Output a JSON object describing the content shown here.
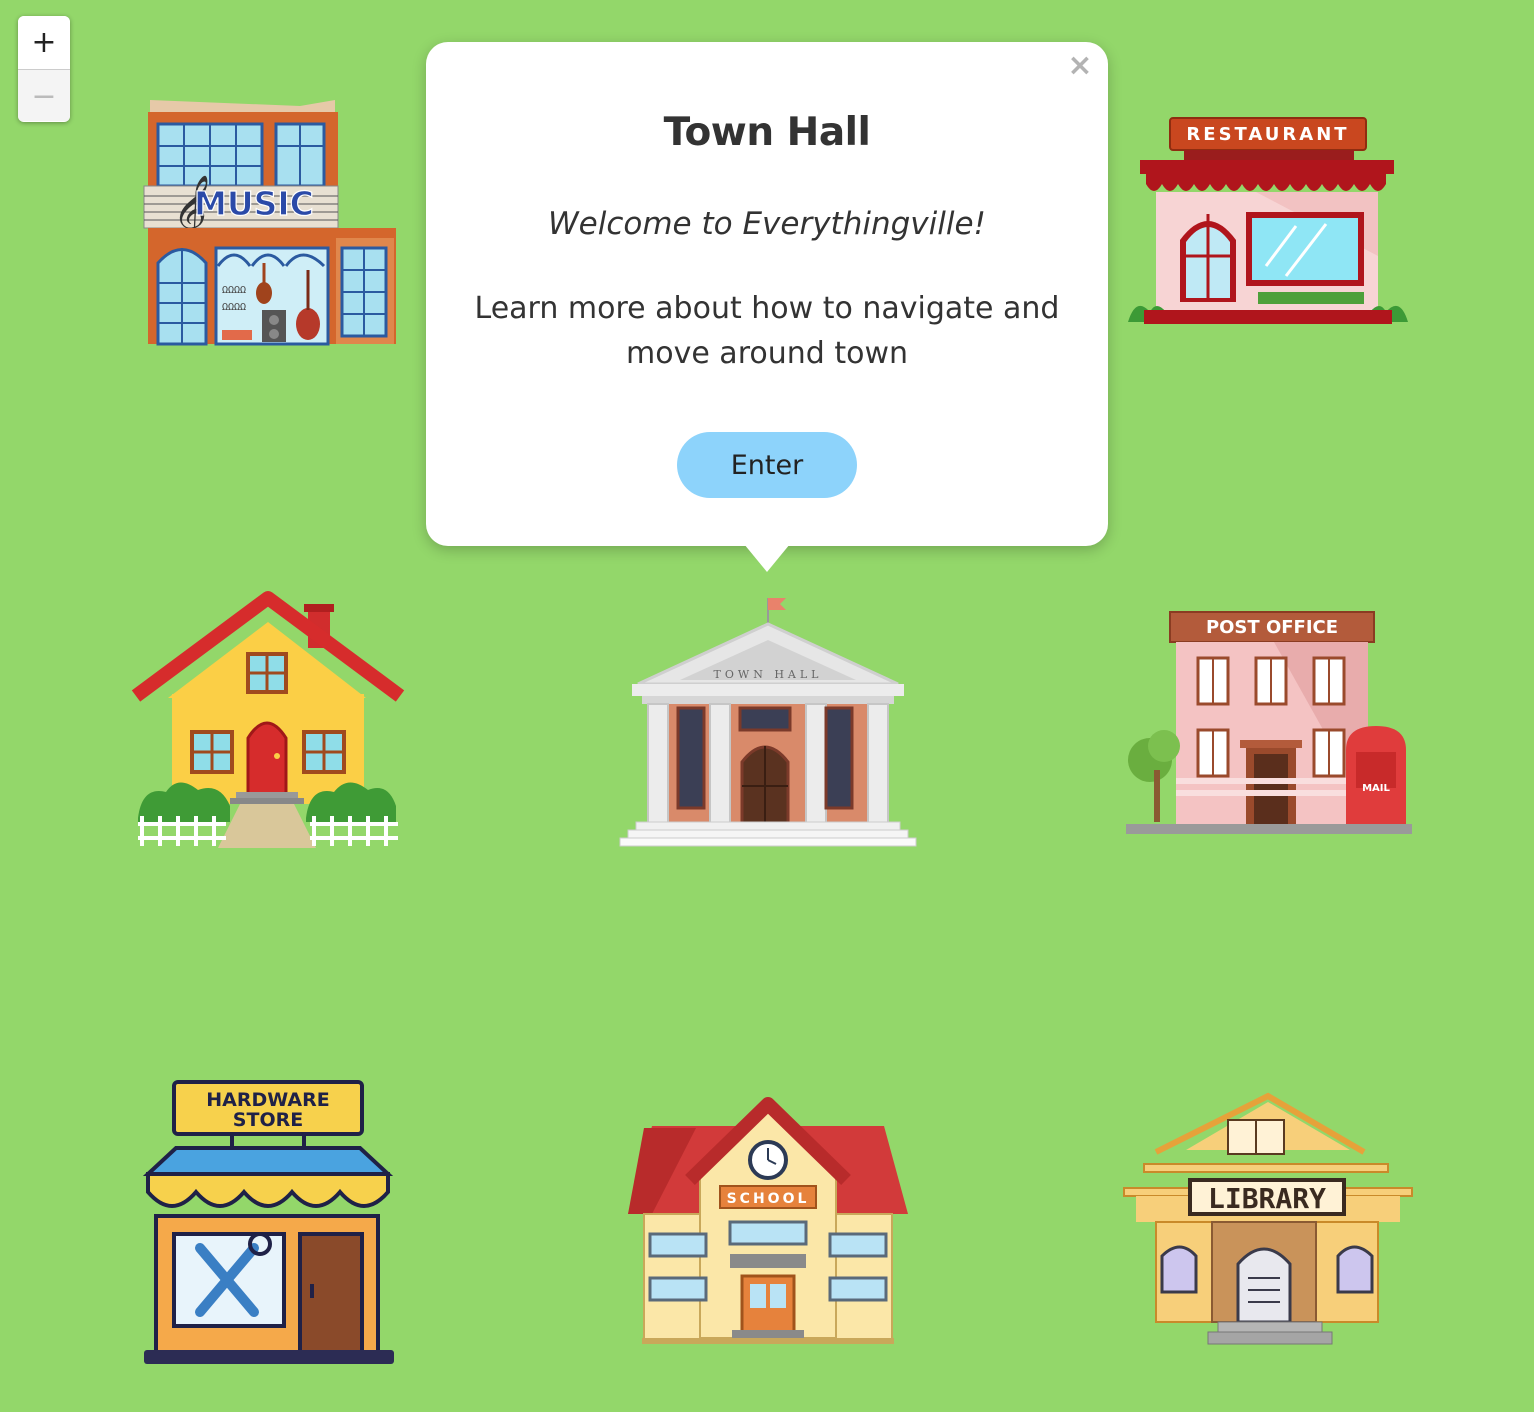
{
  "zoom": {
    "in_label": "+",
    "out_label": "−"
  },
  "popup": {
    "title": "Town Hall",
    "welcome": "Welcome to Everythingville!",
    "text": "Learn more about how to navigate and move around town",
    "button_label": "Enter",
    "close_label": "×"
  },
  "buildings": {
    "music": "MUSIC",
    "restaurant": "RESTAURANT",
    "town_hall": "TOWN HALL",
    "post_office": "POST OFFICE",
    "mail": "MAIL",
    "hardware": [
      "HARDWARE",
      "STORE"
    ],
    "school": "SCHOOL",
    "library": "LIBRARY"
  },
  "colors": {
    "grass": "#93d76a",
    "popup_button": "#8dd3fb"
  }
}
